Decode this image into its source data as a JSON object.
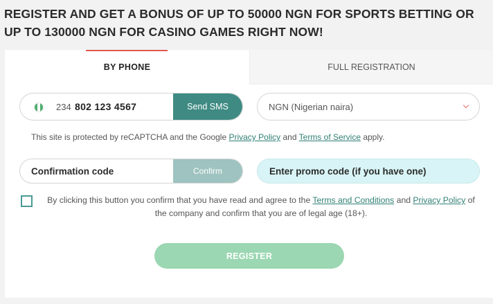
{
  "headline": "REGISTER AND GET A BONUS OF UP TO 50000 NGN FOR SPORTS BETTING OR UP TO 130000 NGN FOR CASINO GAMES RIGHT NOW!",
  "tabs": {
    "phone": "BY PHONE",
    "full": "FULL REGISTRATION"
  },
  "phone": {
    "country_icon": "nigeria-flag-icon",
    "code": "234",
    "number": "802 123 4567",
    "send_sms_label": "Send SMS"
  },
  "currency": {
    "selected": "NGN (Nigerian naira)",
    "icon": "chevron-down-icon"
  },
  "captcha": {
    "prefix": "This site is protected by reCAPTCHA and the Google ",
    "privacy_link": "Privacy Policy",
    "and": " and ",
    "terms_link": "Terms of Service",
    "suffix": " apply."
  },
  "confirmation": {
    "label": "Confirmation code",
    "button": "Confirm"
  },
  "promo": {
    "placeholder": "Enter promo code (if you have one)"
  },
  "consent": {
    "prefix": "By clicking this button you confirm that you have read and agree to the ",
    "terms_link": "Terms and Conditions",
    "and": " and ",
    "privacy_link": "Privacy Policy",
    "suffix": " of the company and confirm that you are of legal age (18+)."
  },
  "register_label": "REGISTER",
  "colors": {
    "accent": "#3f8b83",
    "tab_indicator": "#e0584f",
    "register": "#9bd7b2",
    "promo_bg": "#d8f4f6"
  }
}
